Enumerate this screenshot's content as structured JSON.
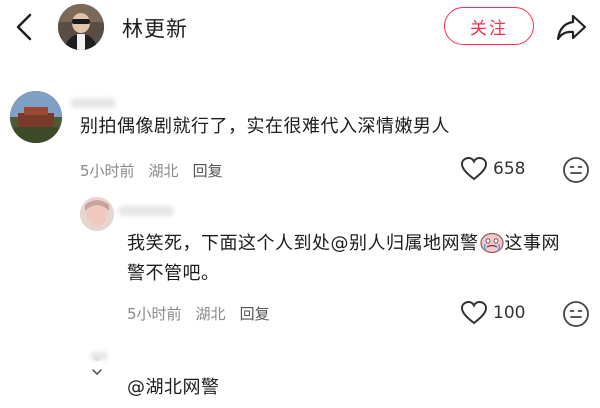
{
  "header": {
    "name": "林更新",
    "follow_label": "关注"
  },
  "comments": [
    {
      "text": "别拍偶像剧就行了，实在很难代入深情嫩男人",
      "time": "5小时前",
      "location": "湖北",
      "reply_label": "回复",
      "likes": "658"
    },
    {
      "text_before": "我笑死，下面这个人到处@别人归属地网警",
      "text_after": "这事网警不管吧。",
      "time": "5小时前",
      "location": "湖北",
      "reply_label": "回复",
      "likes": "100"
    },
    {
      "text": "@湖北网警"
    }
  ],
  "icons": {
    "back": "chevron-left-icon",
    "share": "share-arrow-icon",
    "like": "heart-outline-icon",
    "emoji": "smiley-face-icon",
    "inline_emoji": "crying-face-emoji"
  },
  "colors": {
    "accent": "#ff2e4d",
    "meta_text": "#8a8a8a"
  }
}
